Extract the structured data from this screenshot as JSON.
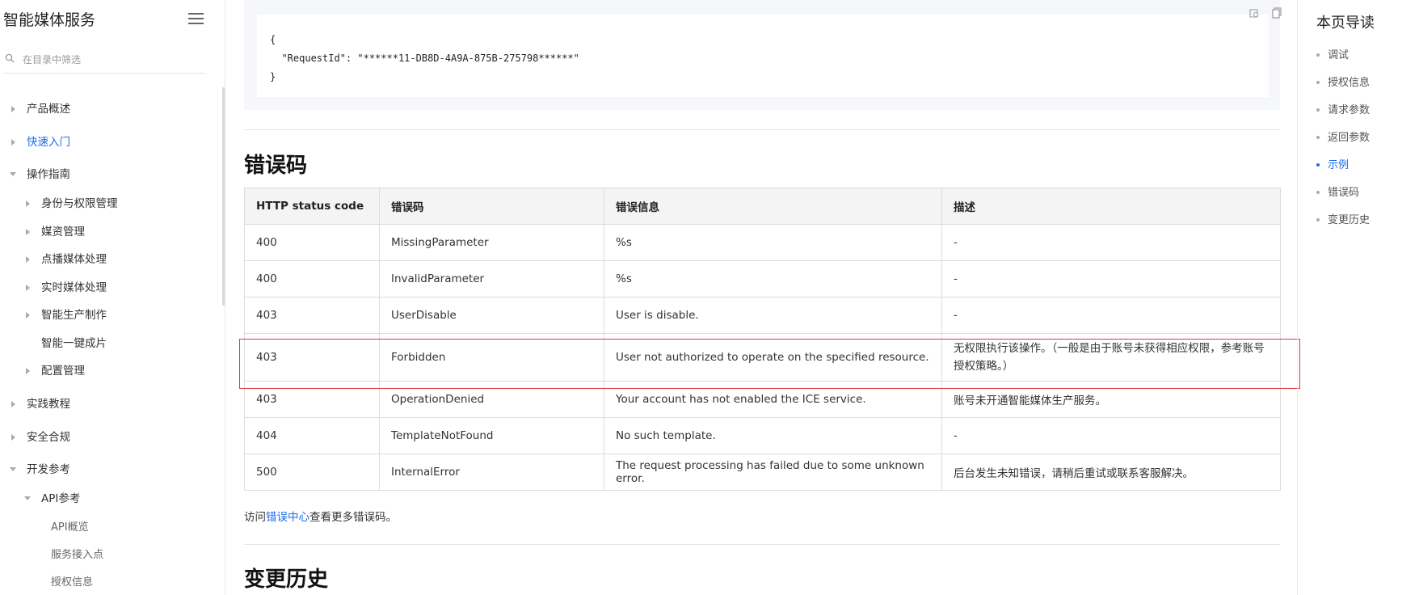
{
  "sidebar": {
    "title": "智能媒体服务",
    "filter_placeholder": "在目录中筛选",
    "items": [
      {
        "label": "产品概述"
      },
      {
        "label": "快速入门"
      },
      {
        "label": "操作指南"
      },
      {
        "label": "身份与权限管理"
      },
      {
        "label": "媒资管理"
      },
      {
        "label": "点播媒体处理"
      },
      {
        "label": "实时媒体处理"
      },
      {
        "label": "智能生产制作"
      },
      {
        "label": "智能一键成片"
      },
      {
        "label": "配置管理"
      },
      {
        "label": "实践教程"
      },
      {
        "label": "安全合规"
      },
      {
        "label": "开发参考"
      },
      {
        "label": "API参考"
      },
      {
        "label": "API概览"
      },
      {
        "label": "服务接入点"
      },
      {
        "label": "授权信息"
      }
    ]
  },
  "code": {
    "line1": "{",
    "line2": "  \"RequestId\": \"******11-DB8D-4A9A-875B-275798******\"",
    "line3": "}"
  },
  "errors": {
    "heading": "错误码",
    "headers": [
      "HTTP status code",
      "错误码",
      "错误信息",
      "描述"
    ],
    "rows": [
      [
        "400",
        "MissingParameter",
        "%s",
        "-"
      ],
      [
        "400",
        "InvalidParameter",
        "%s",
        "-"
      ],
      [
        "403",
        "UserDisable",
        "User is disable.",
        "-"
      ],
      [
        "403",
        "Forbidden",
        "User not authorized to operate on the specified resource.",
        "无权限执行该操作。（一般是由于账号未获得相应权限，参考账号授权策略。）"
      ],
      [
        "403",
        "OperationDenied",
        "Your account has not enabled the ICE service.",
        "账号未开通智能媒体生产服务。"
      ],
      [
        "404",
        "TemplateNotFound",
        "No such template.",
        "-"
      ],
      [
        "500",
        "InternalError",
        "The request processing has failed due to some unknown error.",
        "后台发生未知错误，请稍后重试或联系客服解决。"
      ]
    ],
    "more_prefix": "访问",
    "more_link": "错误中心",
    "more_suffix": "查看更多错误码。"
  },
  "history": {
    "heading": "变更历史"
  },
  "toc": {
    "title": "本页导读",
    "items": [
      {
        "label": "调试"
      },
      {
        "label": "授权信息"
      },
      {
        "label": "请求参数"
      },
      {
        "label": "返回参数"
      },
      {
        "label": "示例"
      },
      {
        "label": "错误码"
      },
      {
        "label": "变更历史"
      }
    ]
  },
  "colors": {
    "accent": "#1a6cf0",
    "highlight_border": "#e0353b"
  }
}
